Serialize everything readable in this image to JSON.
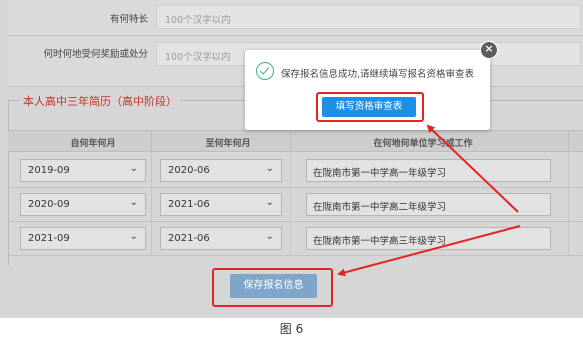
{
  "form": {
    "rows": [
      {
        "label": "有何特长",
        "placeholder": "100个汉字以内"
      },
      {
        "label": "何时何地受何奖励或处分",
        "placeholder": "100个汉字以内"
      }
    ]
  },
  "resume": {
    "title": "本人高中三年简历（高中阶段）",
    "headers": [
      "自何年何月",
      "至何年何月",
      "在何地何单位学习或工作"
    ],
    "rows": [
      {
        "from": "2019-09",
        "to": "2020-06",
        "place": "在陇南市第一中学高一年级学习"
      },
      {
        "from": "2020-09",
        "to": "2021-06",
        "place": "在陇南市第一中学高二年级学习"
      },
      {
        "from": "2021-09",
        "to": "2021-06",
        "place": "在陇南市第一中学高三年级学习"
      }
    ]
  },
  "save_button": "保存报名信息",
  "modal": {
    "message": "保存报名信息成功,请继续填写报名资格审查表",
    "action": "填写资格审查表",
    "close": "×"
  },
  "caption": "图 6",
  "colors": {
    "highlight": "#e52421",
    "primary": "#1f8fe3",
    "success": "#43b37a",
    "section_title": "#c0352c"
  },
  "icons": {
    "success": "check-circle-icon",
    "close": "close-icon",
    "select": "chevron-down-icon"
  }
}
